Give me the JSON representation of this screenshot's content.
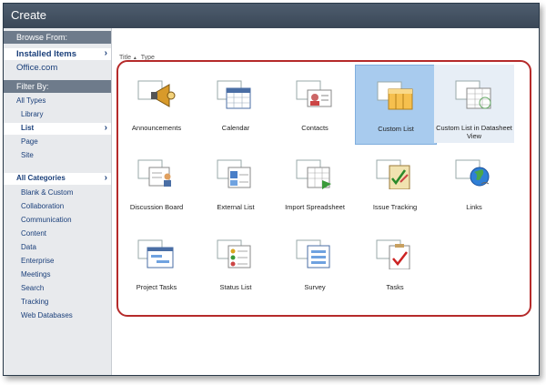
{
  "window": {
    "title": "Create"
  },
  "sidebar": {
    "browse_header": "Browse From:",
    "installed_items": "Installed Items",
    "office_com": "Office.com",
    "filter_header": "Filter By:",
    "all_types": "All Types",
    "types": [
      "Library",
      "List",
      "Page",
      "Site"
    ],
    "all_categories": "All Categories",
    "categories": [
      "Blank & Custom",
      "Collaboration",
      "Communication",
      "Content",
      "Data",
      "Enterprise",
      "Meetings",
      "Search",
      "Tracking",
      "Web Databases"
    ]
  },
  "sort": {
    "title": "Title",
    "arrow": "▲",
    "type": "Type"
  },
  "tiles": [
    {
      "label": "Announcements",
      "icon": "megaphone-icon"
    },
    {
      "label": "Calendar",
      "icon": "calendar-icon"
    },
    {
      "label": "Contacts",
      "icon": "contact-card-icon"
    },
    {
      "label": "Custom List",
      "icon": "custom-list-icon"
    },
    {
      "label": "Custom List in Datasheet View",
      "icon": "datasheet-icon"
    },
    {
      "label": "Discussion Board",
      "icon": "discussion-icon"
    },
    {
      "label": "External List",
      "icon": "external-list-icon"
    },
    {
      "label": "Import Spreadsheet",
      "icon": "import-spreadsheet-icon"
    },
    {
      "label": "Issue Tracking",
      "icon": "issue-tracking-icon"
    },
    {
      "label": "Links",
      "icon": "globe-link-icon"
    },
    {
      "label": "Project Tasks",
      "icon": "gantt-icon"
    },
    {
      "label": "Status List",
      "icon": "status-list-icon"
    },
    {
      "label": "Survey",
      "icon": "survey-icon"
    },
    {
      "label": "Tasks",
      "icon": "task-check-icon"
    }
  ],
  "colors": {
    "accent_selected": "#a8cbee",
    "highlight_border": "#b52a2a",
    "link": "#1a3f7a"
  }
}
